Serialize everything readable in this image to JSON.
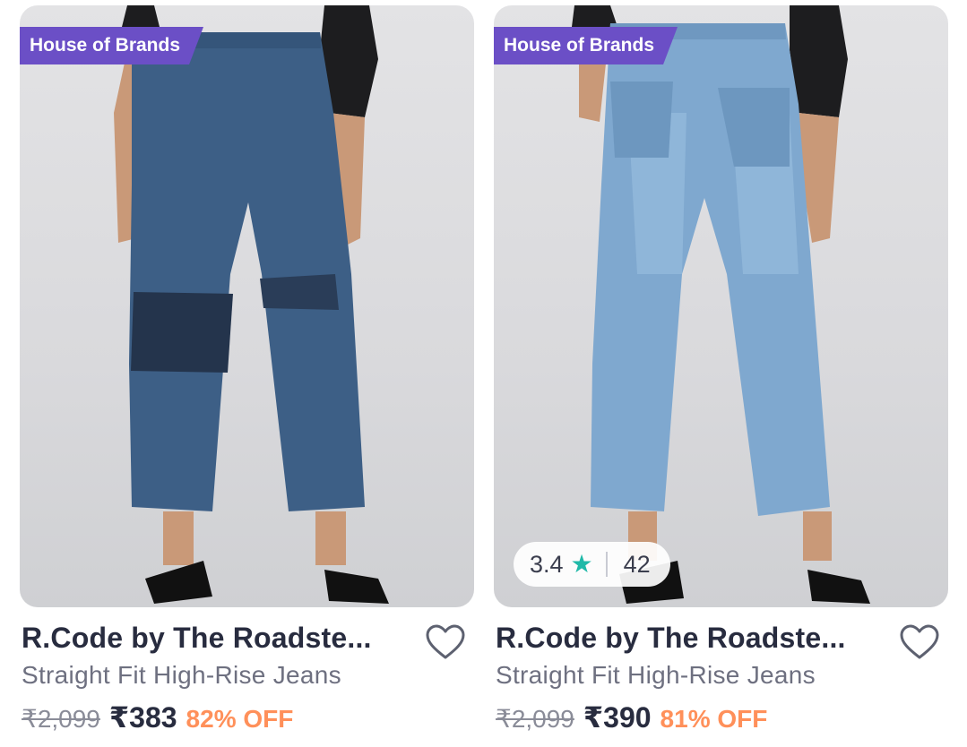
{
  "products": [
    {
      "brand_tag": "House of Brands",
      "title": "R.Code by The Roadste...",
      "subtitle": "Straight Fit High-Rise Jeans",
      "mrp": "₹2,099",
      "price": "₹383",
      "discount": "82% OFF",
      "jeans_color": "#3d5f86",
      "wishlist_icon": "heart-outline-icon"
    },
    {
      "brand_tag": "House of Brands",
      "title": "R.Code by The Roadste...",
      "subtitle": "Straight Fit High-Rise Jeans",
      "mrp": "₹2,099",
      "price": "₹390",
      "discount": "81% OFF",
      "rating": "3.4",
      "rating_icon": "star-icon",
      "rating_count": "42",
      "jeans_color": "#7fa8cf",
      "wishlist_icon": "heart-outline-icon"
    }
  ],
  "colors": {
    "brand_tag_bg": "#6b4fc6",
    "discount": "#ff905a",
    "star": "#1fb9a8"
  }
}
